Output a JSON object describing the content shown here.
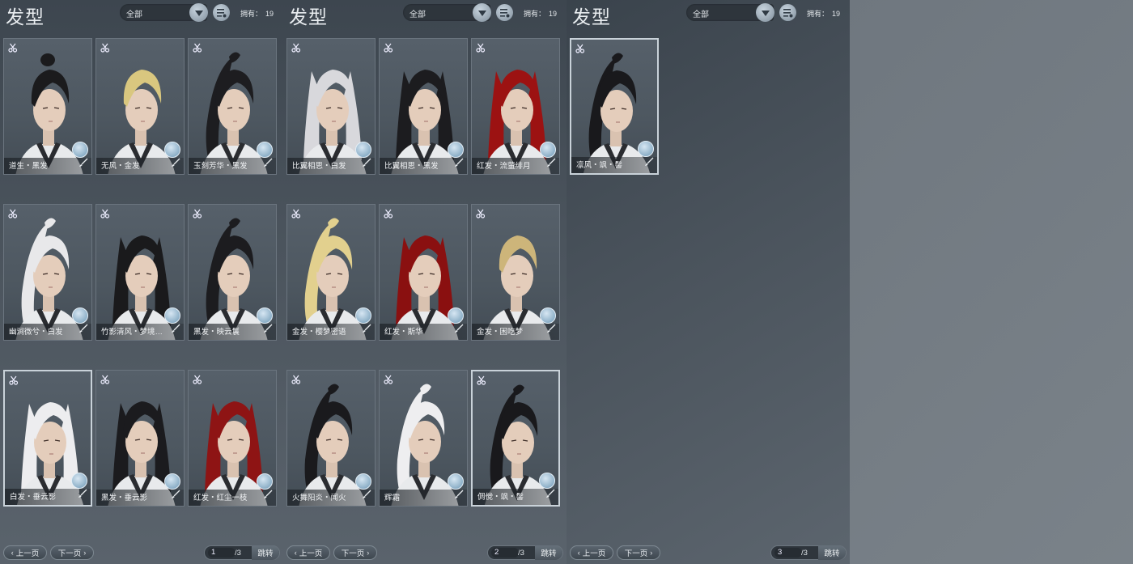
{
  "panels": [
    {
      "title": "发型",
      "filter": "全部",
      "owned_label": "拥有：",
      "owned_count": "19",
      "cards": [
        {
          "label": "道生・黑发",
          "hair": "#1b1b1d",
          "style": "bun",
          "selected": false
        },
        {
          "label": "无风・金发",
          "hair": "#d9c77f",
          "style": "short",
          "selected": false
        },
        {
          "label": "玉刻芳华・黑发",
          "hair": "#1d1d20",
          "style": "pony",
          "selected": false
        },
        {
          "label": "幽涧微兮・白发",
          "hair": "#e8e8ea",
          "style": "pony",
          "selected": false
        },
        {
          "label": "竹影清风・梦境…",
          "hair": "#1a1a1c",
          "style": "long",
          "selected": false
        },
        {
          "label": "黑发・映云鬟",
          "hair": "#1c1c1f",
          "style": "pony",
          "selected": false
        },
        {
          "label": "白发・垂云影",
          "hair": "#ededef",
          "style": "long",
          "selected": true
        },
        {
          "label": "黑发・垂云影",
          "hair": "#1b1b1e",
          "style": "long",
          "selected": false
        },
        {
          "label": "红发・红尘一枝",
          "hair": "#8e1414",
          "style": "long",
          "selected": false
        }
      ],
      "prev": "上一页",
      "next": "下一页",
      "page": "1",
      "total": "/3",
      "jump": "跳转"
    },
    {
      "title": "发型",
      "filter": "全部",
      "owned_label": "拥有：",
      "owned_count": "19",
      "cards": [
        {
          "label": "比翼相思・白发",
          "hair": "#d8d8dc",
          "style": "long",
          "selected": false
        },
        {
          "label": "比翼相思・黑发",
          "hair": "#1c1c1f",
          "style": "long",
          "selected": false
        },
        {
          "label": "红发・流萤绯月",
          "hair": "#9c1212",
          "style": "long",
          "selected": false
        },
        {
          "label": "金发・樱梦密语",
          "hair": "#e2d08e",
          "style": "pony",
          "selected": false
        },
        {
          "label": "红发・斯华",
          "hair": "#8a1010",
          "style": "long",
          "selected": false
        },
        {
          "label": "金发・困吃梦",
          "hair": "#cdb57a",
          "style": "short",
          "selected": false
        },
        {
          "label": "火舞阳炎・闻火",
          "hair": "#1a1a1d",
          "style": "pony",
          "selected": false
        },
        {
          "label": "辉霜",
          "hair": "#eeeef0",
          "style": "pony",
          "selected": false
        },
        {
          "label": "倜傥・飒・髻",
          "hair": "#19191c",
          "style": "pony",
          "selected": true
        }
      ],
      "prev": "上一页",
      "next": "下一页",
      "page": "2",
      "total": "/3",
      "jump": "跳转"
    },
    {
      "title": "发型",
      "filter": "全部",
      "owned_label": "拥有：",
      "owned_count": "19",
      "cards": [
        {
          "label": "凛风・飒・髻",
          "hair": "#19191c",
          "style": "pony",
          "selected": true
        }
      ],
      "prev": "上一页",
      "next": "下一页",
      "page": "3",
      "total": "/3",
      "jump": "跳转"
    }
  ]
}
